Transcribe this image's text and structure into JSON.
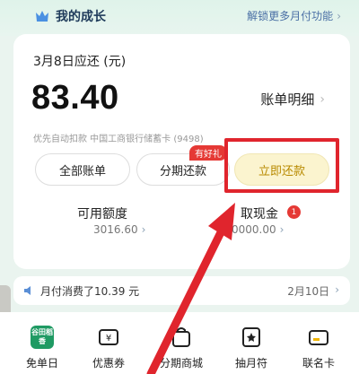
{
  "header": {
    "growth_label": "我的成长",
    "unlock_label": "解锁更多月付功能"
  },
  "bill": {
    "due_label": "3月8日应还 (元)",
    "amount": "83.40",
    "detail_label": "账单明细",
    "auto_debit": "优先自动扣款  中国工商银行储蓄卡 (9498)"
  },
  "buttons": {
    "all_bills": "全部账单",
    "installment": "分期还款",
    "installment_tag": "有好礼",
    "repay_now": "立即还款"
  },
  "limits": {
    "available_label": "可用额度",
    "available_value": "3016.60",
    "cash_label": "取现金",
    "cash_badge": "1",
    "cash_value": "0000.00"
  },
  "spend": {
    "text": "月付消费了10.39 元",
    "date": "2月10日"
  },
  "bottom_nav": [
    {
      "label": "免单日",
      "icon": "brand-tile-icon",
      "brand_text": "谷田稻香"
    },
    {
      "label": "优惠券",
      "icon": "coupon-icon"
    },
    {
      "label": "分期商城",
      "icon": "shopping-bag-icon"
    },
    {
      "label": "抽月符",
      "icon": "lottery-icon"
    },
    {
      "label": "联名卡",
      "icon": "card-icon"
    }
  ],
  "colors": {
    "accent_green": "#1f9a63",
    "repay_bg": "#fbf4cf",
    "highlight_red": "#e0252d",
    "badge_red": "#e53935"
  }
}
